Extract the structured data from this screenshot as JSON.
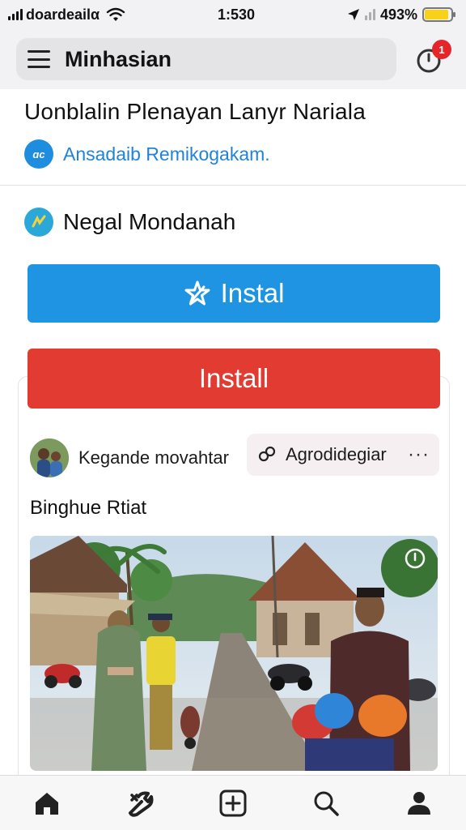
{
  "status_bar": {
    "carrier": "doardeailα",
    "time": "1:530",
    "battery_pct": "493%",
    "battery_level": 0.9,
    "icons": [
      "signal-bars-icon",
      "wifi-icon",
      "location-arrow-icon",
      "battery-icon"
    ]
  },
  "header": {
    "title": "Minhasian",
    "notification_count": "1"
  },
  "app": {
    "title": "Uonblalin Plenayan Lanyr Nariala",
    "developer": "Ansadaib Remikogakam.",
    "developer_icon_text": "ɑc",
    "section_title": "Negal Mondanah"
  },
  "buttons": {
    "install_primary": "Instal",
    "install_secondary": "Install"
  },
  "post": {
    "author": "Kegande movahtar",
    "chip_label": "Agrodidegiar",
    "more_label": "···",
    "caption": "Binghue Rtiat"
  },
  "bottom_nav": {
    "items": [
      "home-icon",
      "tools-icon",
      "add-icon",
      "search-icon",
      "profile-icon"
    ]
  },
  "colors": {
    "accent_blue": "#1f94e3",
    "accent_red": "#e23b31",
    "badge_red": "#e4262a",
    "link_blue": "#2183d8"
  }
}
